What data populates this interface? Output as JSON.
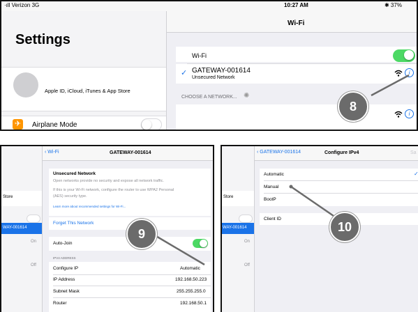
{
  "panel1": {
    "status": {
      "carrier": "·ıll Verizon 3G",
      "time": "10:27 AM",
      "battery": "✱ 37%"
    },
    "settings_title": "Settings",
    "apple_id_label": "Apple ID, iCloud, iTunes & App Store",
    "airplane_mode_label": "Airplane Mode",
    "wifi_nav_title": "Wi-Fi",
    "wifi_label": "Wi-Fi",
    "wifi_on": true,
    "network_name": "GATEWAY-001614",
    "network_subtitle": "Unsecured Network",
    "choose_network_header": "CHOOSE A NETWORK...",
    "callout": "8"
  },
  "panel2": {
    "back_label": "Wi-Fi",
    "nav_title": "GATEWAY-001614",
    "sidebar_store": "Store",
    "sidebar_selected": "WAY-001614",
    "sidebar_on": "On",
    "sidebar_off": "Off",
    "warning_title": "Unsecured Network",
    "warning_line1": "Open networks provide no security and expose all network traffic.",
    "warning_line2": "If this is your Wi-Fi network, configure the router to use WPA2 Personal",
    "warning_line3": "(AES) security type.",
    "learn_more": "Learn more about recommended settings for Wi-Fi...",
    "forget_label": "Forget This Network",
    "auto_join_label": "Auto-Join",
    "auto_join_on": true,
    "ipv4_header": "IPV4 ADDRESS",
    "configure_ip_label": "Configure IP",
    "configure_ip_value": "Automatic",
    "ip_address_label": "IP Address",
    "ip_address_value": "192.168.50.223",
    "subnet_label": "Subnet Mask",
    "subnet_value": "255.255.255.0",
    "router_label": "Router",
    "router_value": "192.168.50.1",
    "callout": "9"
  },
  "panel3": {
    "back_label": "GATEWAY-001614",
    "nav_title": "Configure IPv4",
    "nav_right": "Sa",
    "sidebar_store": "Store",
    "sidebar_selected": "WAY-001614",
    "sidebar_on": "On",
    "sidebar_off": "Off",
    "option_automatic": "Automatic",
    "option_manual": "Manual",
    "option_bootp": "BootP",
    "client_id_label": "Client ID",
    "callout": "10"
  },
  "colors": {
    "ios_blue": "#1a73e8",
    "toggle_green": "#4cd964",
    "callout_gray": "#6b6b6b",
    "airplane_orange": "#ff9500"
  }
}
